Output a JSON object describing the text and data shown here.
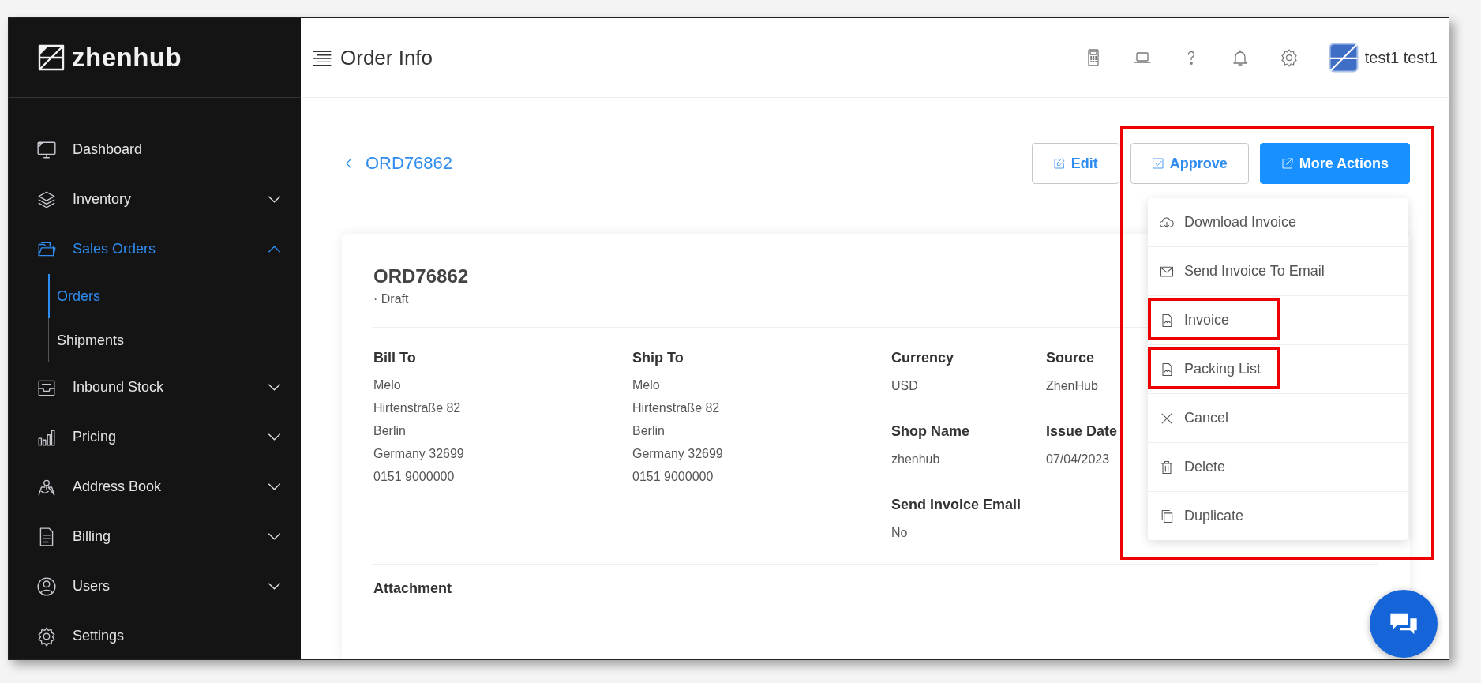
{
  "app": {
    "logo": "zhenhub"
  },
  "sidebar": {
    "items": [
      {
        "kind": "link",
        "label": "Dashboard",
        "active": false
      },
      {
        "kind": "group",
        "label": "Inventory",
        "active": false,
        "expanded": false
      },
      {
        "kind": "group",
        "label": "Sales Orders",
        "active": true,
        "expanded": true,
        "children": [
          {
            "label": "Orders",
            "selected": true
          },
          {
            "label": "Shipments",
            "selected": false
          }
        ]
      },
      {
        "kind": "group",
        "label": "Inbound Stock",
        "active": false,
        "expanded": false
      },
      {
        "kind": "group",
        "label": "Pricing",
        "active": false,
        "expanded": false
      },
      {
        "kind": "group",
        "label": "Address Book",
        "active": false,
        "expanded": false
      },
      {
        "kind": "group",
        "label": "Billing",
        "active": false,
        "expanded": false
      },
      {
        "kind": "group",
        "label": "Users",
        "active": false,
        "expanded": false
      },
      {
        "kind": "link",
        "label": "Settings",
        "active": false
      }
    ]
  },
  "header": {
    "title": "Order Info",
    "user": "test1 test1"
  },
  "toolbar": {
    "back_label": "ORD76862",
    "buttons": [
      {
        "kind": "outline",
        "label": "Edit"
      },
      {
        "kind": "outline",
        "label": "Approve"
      },
      {
        "kind": "primary",
        "label": "More Actions"
      }
    ]
  },
  "menu": {
    "open": true,
    "annotated": true,
    "items": [
      {
        "label": "Download Invoice",
        "annotated": false
      },
      {
        "label": "Send Invoice To Email",
        "annotated": false
      },
      {
        "label": "Invoice",
        "annotated": true
      },
      {
        "label": "Packing List",
        "annotated": true
      },
      {
        "label": "Cancel",
        "annotated": false
      },
      {
        "label": "Delete",
        "annotated": false
      },
      {
        "label": "Duplicate",
        "annotated": false
      }
    ]
  },
  "order": {
    "number": "ORD76862",
    "status": "· Draft",
    "addresses": [
      {
        "heading": "Bill To",
        "lines": [
          "Melo",
          "Hirtenstraße 82",
          "Berlin",
          "Germany 32699",
          "0151 9000000"
        ]
      },
      {
        "heading": "Ship To",
        "lines": [
          "Melo",
          "Hirtenstraße 82",
          "Berlin",
          "Germany 32699",
          "0151 9000000"
        ]
      }
    ],
    "fields": [
      {
        "label": "Currency",
        "value": "USD"
      },
      {
        "label": "Source",
        "value": "ZhenHub"
      },
      {
        "label": "Shop Name",
        "value": "zhenhub"
      },
      {
        "label": "Issue Date",
        "value": "07/04/2023"
      },
      {
        "label": "Send Invoice Email",
        "value": "No"
      }
    ],
    "attachment_heading": "Attachment"
  }
}
